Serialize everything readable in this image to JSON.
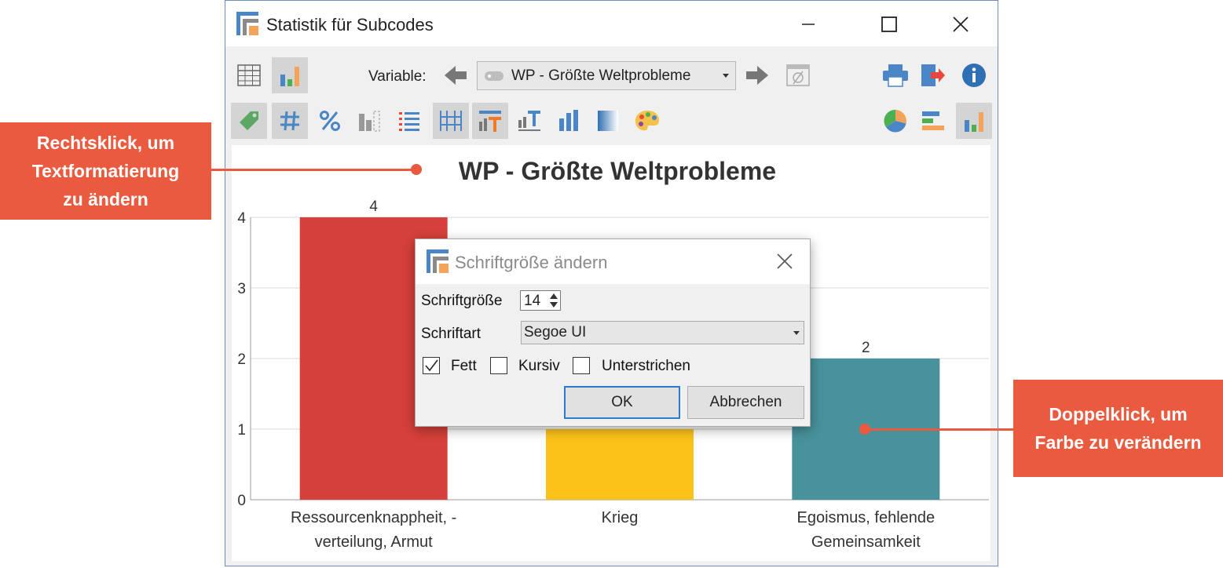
{
  "window": {
    "title": "Statistik für Subcodes"
  },
  "toolbar": {
    "variable_label": "Variable:",
    "variable_value": "WP - Größte Weltprobleme"
  },
  "chart_data": {
    "type": "bar",
    "title": "WP - Größte Weltprobleme",
    "categories": [
      "Ressourcenknappheit, -\nverteilung, Armut",
      "Krieg",
      "Egoismus, fehlende\nGemeinsamkeit"
    ],
    "values": [
      4,
      1,
      2
    ],
    "colors": [
      "#d6403a",
      "#fbc21a",
      "#48929c"
    ],
    "ylim": [
      0,
      4
    ],
    "yticks": [
      0,
      1,
      2,
      3,
      4
    ],
    "data_labels": [
      "4",
      "",
      "2"
    ],
    "grid": true
  },
  "dialog": {
    "title": "Schriftgröße ändern",
    "size_label": "Schriftgröße",
    "size_value": "14",
    "font_label": "Schriftart",
    "font_value": "Segoe UI",
    "bold_label": "Fett",
    "bold_checked": true,
    "italic_label": "Kursiv",
    "italic_checked": false,
    "underline_label": "Unterstrichen",
    "underline_checked": false,
    "ok_label": "OK",
    "cancel_label": "Abbrechen"
  },
  "callouts": {
    "left": "Rechtsklick, um\nTextformatierung\nzu ändern",
    "right": "Doppelklick, um\nFarbe zu verändern"
  },
  "colors": {
    "accent": "#ea5a3f",
    "window_border": "#6c8fb8",
    "icon_blue": "#4a86c5"
  }
}
